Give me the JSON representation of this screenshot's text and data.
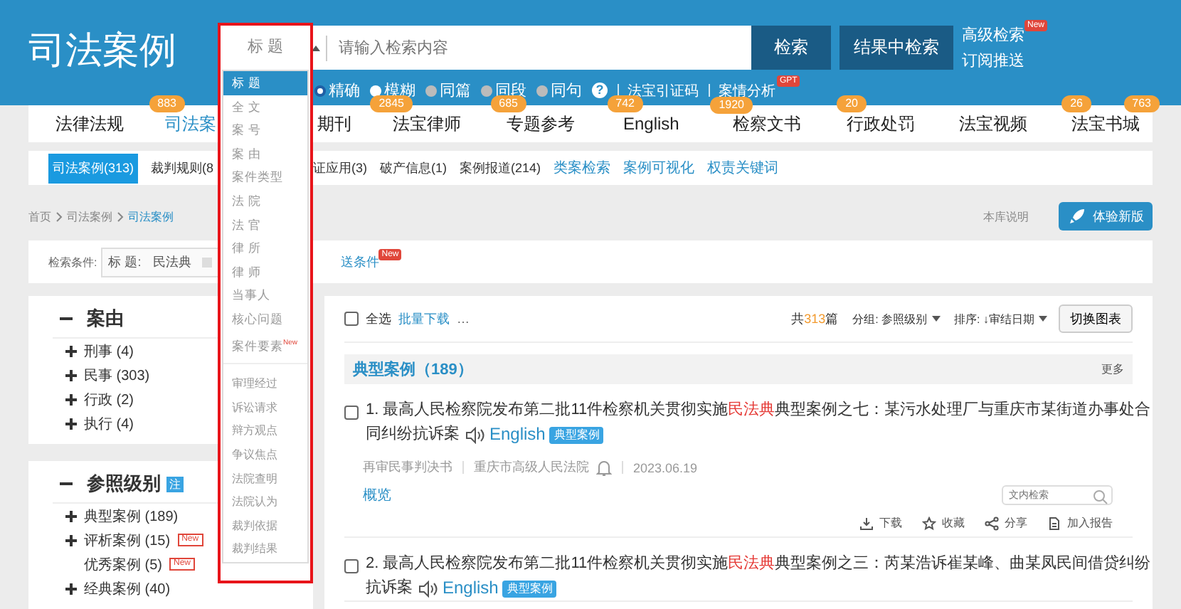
{
  "header": {
    "logo": "司法案例",
    "search": {
      "field_select": "标 题",
      "placeholder": "请输入检索内容",
      "buttons": [
        "检索",
        "结果中检索"
      ],
      "links": [
        {
          "label": "高级检索",
          "badge": "New"
        },
        {
          "label": "订阅推送"
        }
      ]
    },
    "options": [
      {
        "kind": "radio",
        "label": "精确",
        "selected": true
      },
      {
        "kind": "radio",
        "label": "模糊",
        "selected": false
      },
      {
        "kind": "dot",
        "label": "同篇"
      },
      {
        "kind": "dot",
        "label": "同段"
      },
      {
        "kind": "dot",
        "label": "同句"
      },
      {
        "kind": "help",
        "label": "?"
      },
      {
        "kind": "link",
        "label": "法宝引证码"
      },
      {
        "kind": "link",
        "label": "案情分析",
        "badge": "GPT"
      }
    ]
  },
  "tabs": [
    {
      "label": "法律法规",
      "badge": "883",
      "selected": false
    },
    {
      "label": "司法案",
      "selected": true
    },
    {
      "label": "期刊",
      "badge": "2845",
      "selected": false
    },
    {
      "label": "法宝律师",
      "badge": "685",
      "selected": false
    },
    {
      "label": "专题参考",
      "badge": "742",
      "selected": false
    },
    {
      "label": "English",
      "badge": "1920",
      "selected": false
    },
    {
      "label": "检察文书",
      "badge": "20",
      "selected": false
    },
    {
      "label": "行政处罚",
      "selected": false
    },
    {
      "label": "法宝视频",
      "badge": "26",
      "selected": false
    },
    {
      "label": "法宝书城",
      "badge": "763",
      "selected": false
    }
  ],
  "sub_tabs": [
    {
      "label": "司法案例(313)",
      "kind": "tab",
      "selected": true
    },
    {
      "label": "裁判规则(8",
      "kind": "tab",
      "selected": false
    },
    {
      "label": "证应用(3)",
      "kind": "tab",
      "selected": false
    },
    {
      "label": "破产信息(1)",
      "kind": "tab",
      "selected": false
    },
    {
      "label": "案例报道(214)",
      "kind": "tab",
      "selected": false
    },
    {
      "label": "类案检索",
      "kind": "link",
      "selected": false
    },
    {
      "label": "案例可视化",
      "kind": "link",
      "selected": false
    },
    {
      "label": "权责关键词",
      "kind": "link",
      "selected": false
    }
  ],
  "breadcrumb": [
    {
      "label": "首页"
    },
    {
      "label": "司法案例"
    },
    {
      "label": "司法案例"
    }
  ],
  "library_note": "本库说明",
  "try_new_button": "体验新版",
  "conditions": {
    "label": "检索条件:",
    "chip_field": "标 题:",
    "chip_value": "民法典",
    "link": "送条件",
    "link_badge": "New"
  },
  "facets": [
    {
      "title": "案由",
      "items": [
        {
          "label": "刑事 (4)",
          "expandable": true
        },
        {
          "label": "民事 (303)",
          "expandable": true
        },
        {
          "label": "行政 (2)",
          "expandable": true
        },
        {
          "label": "执行 (4)",
          "expandable": true
        }
      ]
    },
    {
      "title": "参照级别",
      "badge": "注",
      "items": [
        {
          "label": "典型案例 (189)",
          "expandable": true
        },
        {
          "label": "评析案例 (15)",
          "expandable": true,
          "badge": "New"
        },
        {
          "label": "优秀案例 (5)",
          "expandable": false,
          "badge": "New"
        },
        {
          "label": "经典案例 (40)",
          "expandable": true
        }
      ]
    }
  ],
  "toolbar": {
    "select_all": "全选",
    "checked": false,
    "batch_download": "批量下载",
    "more": "…",
    "total_prefix": "共",
    "total": "313",
    "total_suffix": "篇",
    "group": "分组: 参照级别",
    "sort": "排序: ↓审结日期",
    "switch_button": "切换图表"
  },
  "group": {
    "title": "典型案例（189）",
    "more": "更多"
  },
  "results": [
    {
      "checked": false,
      "before": "1. 最高人民检察院发布第二批11件检察机关贯彻实施",
      "highlight": "民法典",
      "after": "典型案例之七：某污水处理厂与重庆市某街道办事处合",
      "line2": "同纠纷抗诉案",
      "english": "English",
      "tag": "典型案例",
      "meta": [
        "再审民事判决书",
        "重庆市高级人民法院",
        "2023.06.19"
      ],
      "overview": "概览",
      "search_placeholder": "文内检索",
      "actions": [
        "下载",
        "收藏",
        "分享",
        "加入报告"
      ]
    },
    {
      "checked": false,
      "before": "2. 最高人民检察院发布第二批11件检察机关贯彻实施",
      "highlight": "民法典",
      "after": "典型案例之三：芮某浩诉崔某峰、曲某凤民间借贷纠纷",
      "line2": "抗诉案",
      "english": "English",
      "tag": "典型案例"
    }
  ],
  "field_dropdown": {
    "items": [
      {
        "label": "标 题",
        "selected": true
      },
      {
        "label": "全 文",
        "selected": false
      },
      {
        "label": "案 号",
        "selected": false
      },
      {
        "label": "案 由",
        "selected": false
      },
      {
        "label": "案件类型",
        "selected": false
      },
      {
        "label": "法 院",
        "selected": false
      },
      {
        "label": "法 官",
        "selected": false
      },
      {
        "label": "律 所",
        "selected": false
      },
      {
        "label": "律 师",
        "selected": false
      },
      {
        "label": "当事人",
        "selected": false
      },
      {
        "label": "核心问题",
        "selected": false
      },
      {
        "label": "案件要素",
        "selected": false,
        "badge": "New"
      }
    ],
    "section_items": [
      {
        "label": "审理经过",
        "selected": false
      },
      {
        "label": "诉讼请求",
        "selected": false
      },
      {
        "label": "辩方观点",
        "selected": false
      },
      {
        "label": "争议焦点",
        "selected": false
      },
      {
        "label": "法院查明",
        "selected": false
      },
      {
        "label": "法院认为",
        "selected": false
      },
      {
        "label": "裁判依据",
        "selected": false
      },
      {
        "label": "裁判结果",
        "selected": false
      }
    ]
  }
}
